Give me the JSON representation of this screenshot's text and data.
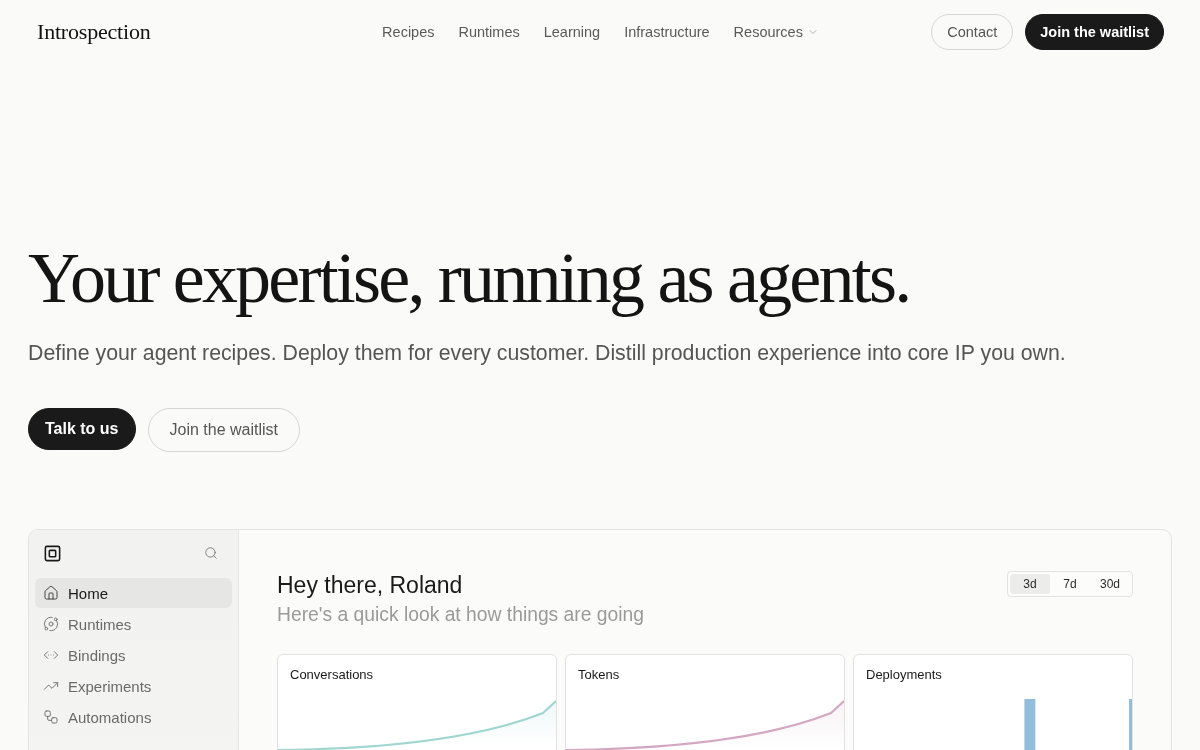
{
  "header": {
    "logo": "Introspection",
    "nav": [
      {
        "label": "Recipes",
        "kind": "link"
      },
      {
        "label": "Runtimes",
        "kind": "link"
      },
      {
        "label": "Learning",
        "kind": "link"
      },
      {
        "label": "Infrastructure",
        "kind": "link"
      },
      {
        "label": "Resources",
        "kind": "dropdown"
      }
    ],
    "buttons": [
      {
        "label": "Contact",
        "kind": "secondary"
      },
      {
        "label": "Join the waitlist",
        "kind": "primary"
      }
    ]
  },
  "hero": {
    "title": "Your expertise, running as agents.",
    "subtitle": "Define your agent recipes. Deploy them for every customer. Distill production experience into core IP you own.",
    "buttons": [
      {
        "label": "Talk to us",
        "kind": "primary"
      },
      {
        "label": "Join the waitlist",
        "kind": "secondary"
      }
    ]
  },
  "app": {
    "sidebar": {
      "items": [
        {
          "label": "Home",
          "selected": true
        },
        {
          "label": "Runtimes",
          "selected": false
        },
        {
          "label": "Bindings",
          "selected": false
        },
        {
          "label": "Experiments",
          "selected": false
        },
        {
          "label": "Automations",
          "selected": false
        }
      ]
    },
    "greeting": "Hey there, Roland",
    "subtitle": "Here's a quick look at how things are going",
    "ranges": [
      {
        "label": "3d",
        "selected": true
      },
      {
        "label": "7d",
        "selected": false
      },
      {
        "label": "30d",
        "selected": false
      }
    ],
    "cards": [
      {
        "title": "Conversations",
        "kind": "line",
        "color": "#9fd6d0"
      },
      {
        "title": "Tokens",
        "kind": "line",
        "color": "#d3a7c1"
      },
      {
        "title": "Deployments",
        "kind": "bar",
        "color": "#93bedb"
      }
    ]
  }
}
